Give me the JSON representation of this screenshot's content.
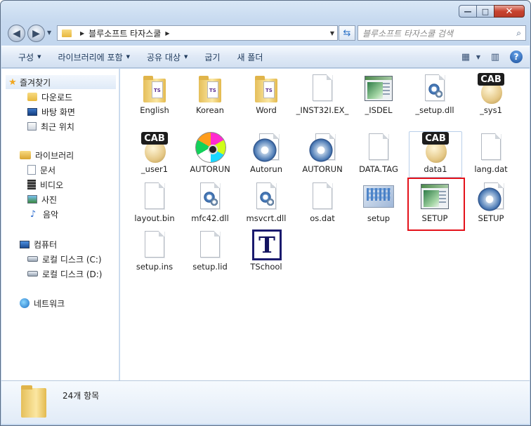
{
  "window": {
    "caption": {
      "minimize": "—",
      "maximize": "□",
      "close": "✕"
    }
  },
  "address": {
    "path": "블루소프트 타자스쿨",
    "search_placeholder": "블루소프트 타자스쿨 검색"
  },
  "toolbar": {
    "items": [
      {
        "label": "구성",
        "has_menu": true
      },
      {
        "label": "라이브러리에 포함",
        "has_menu": true
      },
      {
        "label": "공유 대상",
        "has_menu": true
      },
      {
        "label": "굽기",
        "has_menu": false
      },
      {
        "label": "새 폴더",
        "has_menu": false
      }
    ],
    "help": "?"
  },
  "sidebar": {
    "favorites": {
      "label": "즐겨찾기",
      "items": [
        "다운로드",
        "바탕 화면",
        "최근 위치"
      ]
    },
    "libraries": {
      "label": "라이브러리",
      "items": [
        "문서",
        "비디오",
        "사진",
        "음악"
      ]
    },
    "computer": {
      "label": "컴퓨터",
      "items": [
        "로컬 디스크 (C:)",
        "로컬 디스크 (D:)"
      ]
    },
    "network": {
      "label": "네트워크"
    }
  },
  "files": [
    {
      "name": "English",
      "icon": "folder-icon"
    },
    {
      "name": "Korean",
      "icon": "folder-icon"
    },
    {
      "name": "Word",
      "icon": "folder-icon"
    },
    {
      "name": "_INST32I.EX_",
      "icon": "file-icon"
    },
    {
      "name": "_ISDEL",
      "icon": "app-window-icon"
    },
    {
      "name": "_setup.dll",
      "icon": "dll-icon"
    },
    {
      "name": "_sys1",
      "icon": "cab-icon"
    },
    {
      "name": "_user1",
      "icon": "cab-icon"
    },
    {
      "name": "AUTORUN",
      "icon": "cd-icon"
    },
    {
      "name": "Autorun",
      "icon": "settings-icon"
    },
    {
      "name": "AUTORUN",
      "icon": "settings-icon"
    },
    {
      "name": "DATA.TAG",
      "icon": "file-icon"
    },
    {
      "name": "data1",
      "icon": "cab-icon"
    },
    {
      "name": "lang.dat",
      "icon": "file-icon"
    },
    {
      "name": "layout.bin",
      "icon": "file-icon"
    },
    {
      "name": "mfc42.dll",
      "icon": "dll-icon"
    },
    {
      "name": "msvcrt.dll",
      "icon": "dll-icon"
    },
    {
      "name": "os.dat",
      "icon": "file-icon"
    },
    {
      "name": "setup",
      "icon": "image-icon"
    },
    {
      "name": "SETUP",
      "icon": "app-window-icon"
    },
    {
      "name": "SETUP",
      "icon": "settings-icon"
    },
    {
      "name": "setup.ins",
      "icon": "file-icon"
    },
    {
      "name": "setup.lid",
      "icon": "file-icon"
    },
    {
      "name": "TSchool",
      "icon": "tschool-icon"
    }
  ],
  "icon_text": {
    "cab": "CAB",
    "tschool": "T"
  },
  "details": {
    "count": "24개 항목"
  },
  "colors": {
    "highlight": "#e4111a",
    "accent": "#1e395b"
  }
}
